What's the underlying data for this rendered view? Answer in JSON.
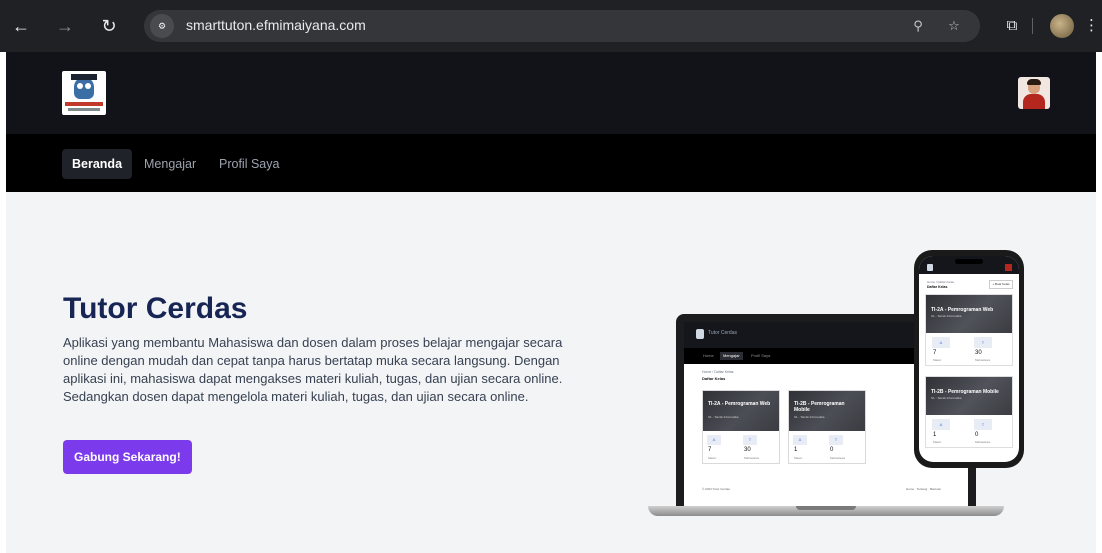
{
  "browser": {
    "url": "smarttuton.efmimaiyana.com",
    "site_info_glyph": "⚙",
    "icons": [
      "back-icon",
      "forward-icon",
      "reload-icon",
      "zoom-icon",
      "star-icon",
      "extensions-icon",
      "profile-icon",
      "menu-icon"
    ]
  },
  "nav": {
    "items": [
      {
        "label": "Beranda"
      },
      {
        "label": "Mengajar"
      },
      {
        "label": "Profil Saya"
      }
    ]
  },
  "hero": {
    "title": "Tutor Cerdas",
    "description": "Aplikasi yang membantu Mahasiswa dan dosen dalam proses belajar mengajar secara online dengan mudah dan cepat tanpa harus bertatap muka secara langsung. Dengan aplikasi ini, mahasiswa dapat mengakses materi kuliah, tugas, dan ujian secara online. Sedangkan dosen dapat mengelola materi kuliah, tugas, dan ujian secara online.",
    "cta_label": "Gabung Sekarang!"
  },
  "mockup": {
    "laptop": {
      "brand": "Tutor Cerdas",
      "nav": [
        "Home",
        "Mengajar",
        "Profil Saya"
      ],
      "breadcrumb": "Home / Daftar Kelas",
      "page_title": "Daftar Kelas",
      "cards": [
        {
          "title": "TI-2A - Pemrograman Web",
          "subtitle": "S1 - Teknik Informatika",
          "stat1_tile": "A",
          "stat1_num": "7",
          "stat1_lbl": "Materi",
          "stat2_tile": "T",
          "stat2_num": "30",
          "stat2_lbl": "Mahasiswa"
        },
        {
          "title": "TI-2B - Pemrograman Mobile",
          "subtitle": "S1 - Teknik Informatika",
          "stat1_tile": "A",
          "stat1_num": "1",
          "stat1_lbl": "Materi",
          "stat2_tile": "T",
          "stat2_num": "0",
          "stat2_lbl": "Mahasiswa"
        }
      ],
      "footer_left": "© 2024 Tutor Cerdas",
      "footer_right": "Home · Tentang · Bantuan"
    },
    "phone": {
      "breadcrumb": "Home / Daftar Kelas",
      "page_title": "Daftar Kelas",
      "button": "+ Buat Kelas",
      "cards": [
        {
          "title": "TI-2A - Pemrograman Web",
          "subtitle": "S1 - Teknik Informatika",
          "stat1_tile": "A",
          "stat1_num": "7",
          "stat1_lbl": "Materi",
          "stat2_tile": "T",
          "stat2_num": "30",
          "stat2_lbl": "Mahasiswa"
        },
        {
          "title": "TI-2B - Pemrograman Mobile",
          "subtitle": "S1 - Teknik Informatika",
          "stat1_tile": "A",
          "stat1_num": "1",
          "stat1_lbl": "Materi",
          "stat2_tile": "T",
          "stat2_num": "0",
          "stat2_lbl": "Mahasiswa"
        }
      ]
    }
  },
  "colors": {
    "accent": "#7c3aed",
    "title": "#172554",
    "header_bg": "#111318",
    "nav_bg": "#000000",
    "hero_bg": "#f3f4f6"
  }
}
